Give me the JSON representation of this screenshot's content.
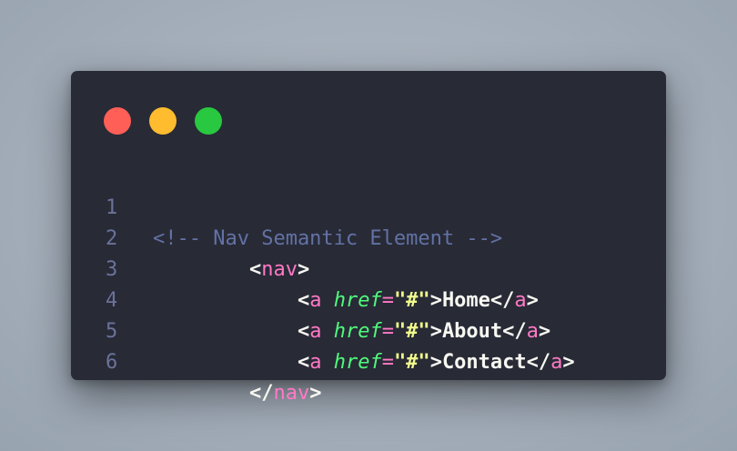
{
  "window_controls": {
    "close_color": "#ff5f57",
    "minimize_color": "#febc2e",
    "maximize_color": "#28c840"
  },
  "code": {
    "lines": [
      {
        "number": "1",
        "indent": "",
        "comment": "<!-- Nav Semantic Element -->"
      },
      {
        "number": "2",
        "indent": "        ",
        "open": "<",
        "tag": "nav",
        "close": ">"
      },
      {
        "number": "3",
        "indent": "            ",
        "open": "<",
        "tag": "a",
        "attr": "href",
        "eq": "=",
        "value": "\"#\"",
        "gt": ">",
        "text": "Home",
        "end_open": "</",
        "end_tag": "a",
        "end_close": ">"
      },
      {
        "number": "4",
        "indent": "            ",
        "open": "<",
        "tag": "a",
        "attr": "href",
        "eq": "=",
        "value": "\"#\"",
        "gt": ">",
        "text": "About",
        "end_open": "</",
        "end_tag": "a",
        "end_close": ">"
      },
      {
        "number": "5",
        "indent": "            ",
        "open": "<",
        "tag": "a",
        "attr": "href",
        "eq": "=",
        "value": "\"#\"",
        "gt": ">",
        "text": "Contact",
        "end_open": "</",
        "end_tag": "a",
        "end_close": ">"
      },
      {
        "number": "6",
        "indent": "        ",
        "open": "</",
        "tag": "nav",
        "close": ">"
      }
    ]
  }
}
